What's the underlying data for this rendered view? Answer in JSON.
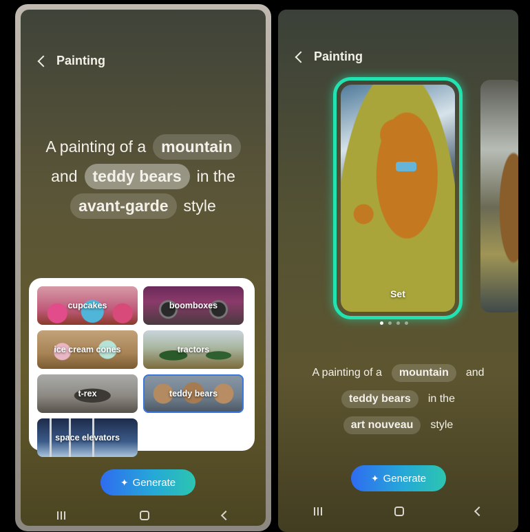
{
  "left": {
    "header": {
      "title": "Painting"
    },
    "prompt": {
      "line1": {
        "text": "A painting of a",
        "chip": "mountain"
      },
      "line2": {
        "pre": "and",
        "chip": "teddy bears",
        "post": "in the"
      },
      "line3": {
        "chip": "avant-garde",
        "post": "style"
      }
    },
    "suggestions": [
      {
        "label": "cupcakes",
        "selected": false
      },
      {
        "label": "boomboxes",
        "selected": false
      },
      {
        "label": "ice cream cones",
        "selected": false
      },
      {
        "label": "tractors",
        "selected": false
      },
      {
        "label": "t-rex",
        "selected": false
      },
      {
        "label": "teddy bears",
        "selected": true
      },
      {
        "label": "space elevators",
        "selected": false
      }
    ],
    "generate_label": "Generate"
  },
  "right": {
    "header": {
      "title": "Painting"
    },
    "preview": {
      "set_label": "Set",
      "page_count": 4,
      "current_page": 1
    },
    "prompt": {
      "line1": {
        "text": "A painting of a",
        "chip": "mountain",
        "post": "and"
      },
      "line2": {
        "chip": "teddy bears",
        "post": "in the"
      },
      "line3": {
        "chip": "art nouveau",
        "post": "style"
      }
    },
    "generate_label": "Generate"
  },
  "icons": {
    "back": "chevron-left-icon",
    "sparkle": "sparkle-icon",
    "nav": [
      "recents-icon",
      "home-icon",
      "back-icon"
    ]
  },
  "colors": {
    "accent_teal": "#22e3b0",
    "generate_gradient_start": "#2f6cf0",
    "generate_gradient_end": "#2cc5b0",
    "selected_outline": "#3a78e0"
  }
}
